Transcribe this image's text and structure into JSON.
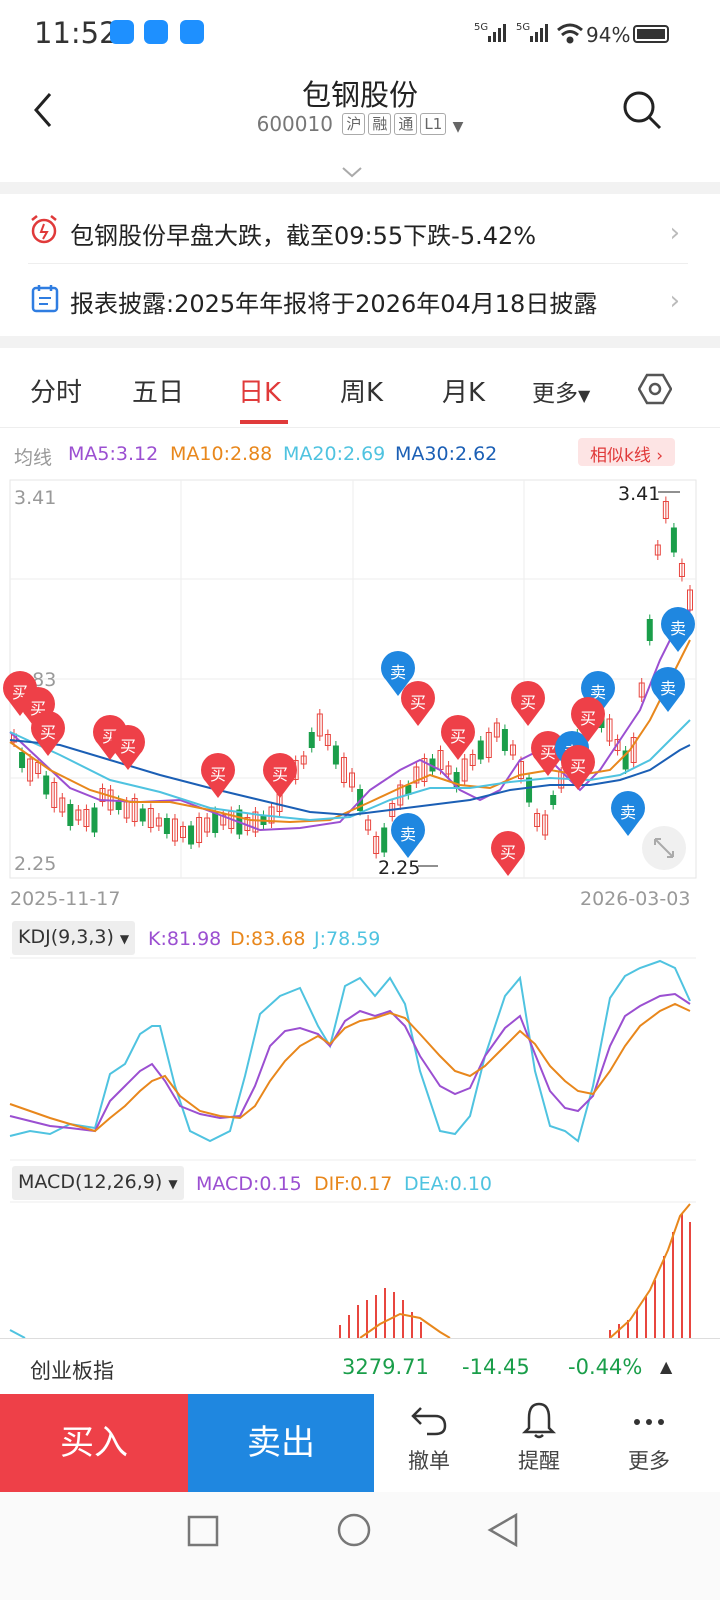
{
  "status": {
    "time": "11:52",
    "battery": "94%",
    "signal1": "5G",
    "signal2": "5G"
  },
  "header": {
    "title": "包钢股份",
    "code": "600010",
    "tags": [
      "沪",
      "融",
      "通",
      "L1"
    ]
  },
  "notices": [
    {
      "text": "包钢股份早盘大跌，截至09:55下跌-5.42%",
      "icon": "alarm-clock-icon"
    },
    {
      "text": "报表披露:2025年年报将于2026年04月18日披露",
      "icon": "calendar-report-icon"
    }
  ],
  "tabs": [
    "分时",
    "五日",
    "日K",
    "周K",
    "月K",
    "更多"
  ],
  "active_tab": "日K",
  "ma": {
    "label": "均线",
    "ma5": "MA5:3.12",
    "ma10": "MA10:2.88",
    "ma20": "MA20:2.69",
    "ma30": "MA30:2.62",
    "similar": "相似k线"
  },
  "colors": {
    "ma5": "#9b4fd1",
    "ma10": "#e8871c",
    "ma20": "#4fc3e0",
    "ma30": "#1b5fb5",
    "up": "#e8463f",
    "down": "#1a9e4a",
    "buy": "#ee4048",
    "sell": "#1f87e0"
  },
  "kline": {
    "price_high": "3.41",
    "price_mid": "2.83",
    "price_low": "2.25",
    "max_label": "3.41",
    "min_label": "2.25",
    "date_start": "2025-11-17",
    "date_end": "2026-03-03",
    "buy_marker": "买",
    "sell_marker": "卖"
  },
  "kdj": {
    "selector": "KDJ(9,3,3)",
    "k": "K:81.98",
    "d": "D:83.68",
    "j": "J:78.59"
  },
  "macd": {
    "selector": "MACD(12,26,9)",
    "macd": "MACD:0.15",
    "dif": "DIF:0.17",
    "dea": "DEA:0.10"
  },
  "bottom_quote": {
    "name": "创业板指",
    "price": "3279.71",
    "change": "-14.45",
    "pct": "-0.44%"
  },
  "actions": {
    "buy": "买入",
    "sell": "卖出",
    "cancel": "撤单",
    "alert": "提醒",
    "more": "更多"
  }
}
